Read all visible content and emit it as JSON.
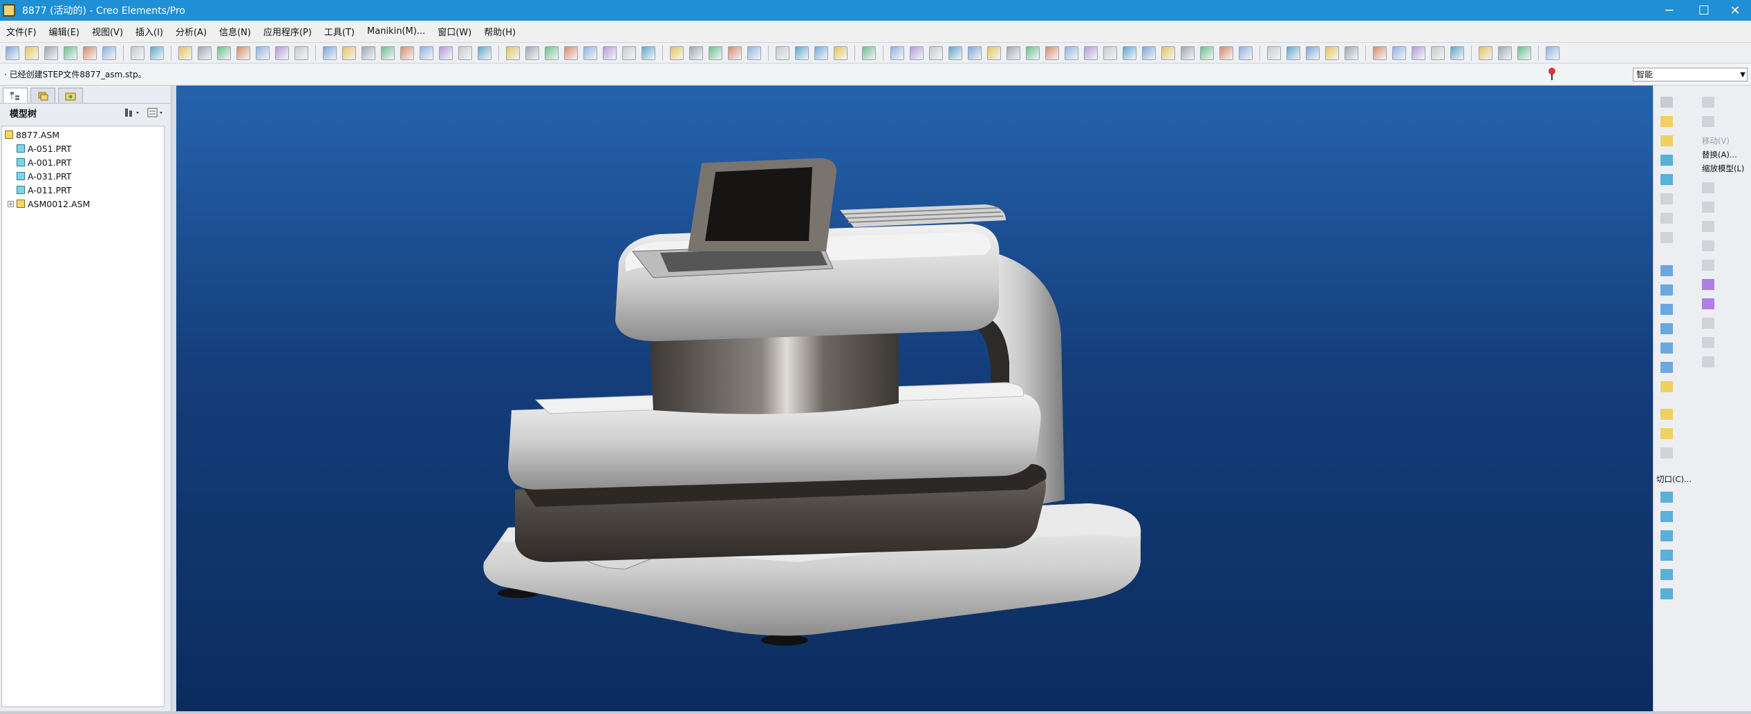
{
  "window": {
    "title": "8877 (活动的) - Creo Elements/Pro",
    "minimize": "─",
    "maximize": "☐",
    "close": "✕"
  },
  "menu": [
    {
      "id": "file",
      "label": "文件(F)"
    },
    {
      "id": "edit",
      "label": "编辑(E)"
    },
    {
      "id": "view",
      "label": "视图(V)"
    },
    {
      "id": "insert",
      "label": "插入(I)"
    },
    {
      "id": "analysis",
      "label": "分析(A)"
    },
    {
      "id": "info",
      "label": "信息(N)"
    },
    {
      "id": "applications",
      "label": "应用程序(P)"
    },
    {
      "id": "tools",
      "label": "工具(T)"
    },
    {
      "id": "manikin",
      "label": "Manikin(M)..."
    },
    {
      "id": "window",
      "label": "窗口(W)"
    },
    {
      "id": "help",
      "label": "帮助(H)"
    }
  ],
  "toolbar": {
    "icons": [
      "new-icon",
      "open-icon",
      "save-icon",
      "print-icon",
      "print-preview-icon",
      "send-mail-icon",
      "sep",
      "undo-icon",
      "redo-icon",
      "sep",
      "cut-icon",
      "copy-icon",
      "paste-icon",
      "paste-special-icon",
      "regenerate-icon",
      "find-icon",
      "select-box-icon",
      "sep",
      "hide-icon",
      "unhide-icon",
      "display-style-icon",
      "named-view-icon",
      "orient-icon",
      "sketch-view-icon",
      "spin-center-icon",
      "appearance-icon",
      "sphere-icon",
      "sep",
      "repaint-icon",
      "pan-icon",
      "zoom-in-icon",
      "zoom-out-icon",
      "refit-icon",
      "reorient-icon",
      "saved-views-icon",
      "layers-icon",
      "sep",
      "wireframe-icon",
      "hidden-line-icon",
      "no-hidden-icon",
      "shading-icon",
      "enhanced-realism-icon",
      "sep",
      "datum-planes-icon",
      "datum-axes-icon",
      "datum-points-icon",
      "coordinate-systems-icon",
      "sep",
      "model-tree-settings-icon",
      "sep",
      "tool-1-icon",
      "tool-2-icon",
      "tool-3-icon",
      "tool-4-icon",
      "tool-5-icon",
      "tool-6-icon",
      "tool-7-icon",
      "tool-8-icon",
      "tool-9-icon",
      "tool-10-icon",
      "tool-11-icon",
      "tool-12-icon",
      "tool-13-icon",
      "tool-14-icon",
      "tool-15-icon",
      "tool-16-icon",
      "tool-17-icon",
      "tool-18-icon",
      "tool-19-icon",
      "sep",
      "app-1-icon",
      "app-2-icon",
      "app-3-icon",
      "app-4-icon",
      "app-5-icon",
      "sep",
      "render-1-icon",
      "render-2-icon",
      "render-3-icon",
      "render-4-icon",
      "render-5-icon",
      "sep",
      "window-new-icon",
      "window-activate-icon",
      "window-close-icon",
      "sep",
      "context-help-icon"
    ]
  },
  "status": {
    "message": "· 已经创建STEP文件8877_asm.stp。",
    "filter_value": "智能"
  },
  "left_panel": {
    "tree_label": "模型树",
    "items": [
      {
        "label": "8877.ASM",
        "type": "asm",
        "level": 0,
        "expander": ""
      },
      {
        "label": "A-051.PRT",
        "type": "prt",
        "level": 1,
        "expander": ""
      },
      {
        "label": "A-001.PRT",
        "type": "prt",
        "level": 1,
        "expander": ""
      },
      {
        "label": "A-031.PRT",
        "type": "prt",
        "level": 1,
        "expander": ""
      },
      {
        "label": "A-011.PRT",
        "type": "prt",
        "level": 1,
        "expander": ""
      },
      {
        "label": "ASM0012.ASM",
        "type": "asm",
        "level": 1,
        "expander": "+"
      }
    ]
  },
  "right_panel": {
    "move_label": "移动(V)",
    "replace_label": "替换(A)...",
    "scale_label": "缩放模型(L)",
    "cut_label": "切口(C)..."
  },
  "colors": {
    "titlebar": "#1f8fd6",
    "viewport_top": "#2563ad",
    "viewport_bottom": "#0c2c5e"
  }
}
